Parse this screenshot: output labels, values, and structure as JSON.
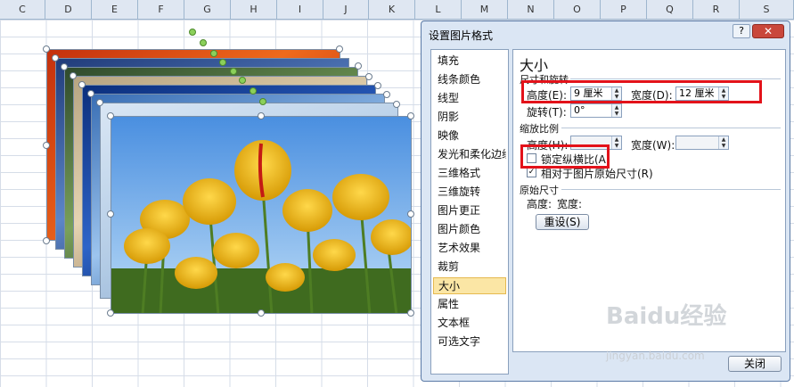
{
  "spreadsheet": {
    "columns": [
      "C",
      "D",
      "E",
      "F",
      "G",
      "H",
      "I",
      "J",
      "K",
      "L",
      "M",
      "N",
      "O",
      "P",
      "Q",
      "R",
      "S"
    ]
  },
  "dialog": {
    "title": "设置图片格式",
    "help_label": "?",
    "close_label": "✕",
    "nav_items": [
      "填充",
      "线条颜色",
      "线型",
      "阴影",
      "映像",
      "发光和柔化边缘",
      "三维格式",
      "三维旋转",
      "图片更正",
      "图片颜色",
      "艺术效果",
      "裁剪",
      "大小",
      "属性",
      "文本框",
      "可选文字"
    ],
    "selected_nav": "大小",
    "pane": {
      "heading": "大小",
      "section_size": "尺寸和旋转",
      "height_label": "高度(E):",
      "height_value": "9 厘米",
      "width_label": "宽度(D):",
      "width_value": "12 厘米",
      "rotation_label": "旋转(T):",
      "rotation_value": "0°",
      "section_scale": "缩放比例",
      "scale_height_label": "高度(H):",
      "scale_height_value": "",
      "scale_width_label": "宽度(W):",
      "scale_width_value": "",
      "lock_aspect_label": "锁定纵横比(A)",
      "relative_label": "相对于图片原始尺寸(R)",
      "section_original": "原始尺寸",
      "original_height_label": "高度:",
      "original_width_label": "宽度:",
      "reset_label": "重设(S)"
    },
    "footer_close_label": "关闭"
  },
  "watermark": {
    "logo_text": "Baidu经验",
    "url_text": "jingyan.baidu.com"
  },
  "colors": {
    "highlight_box": "#e3121a",
    "tulip_yellow": "#f3c20e",
    "sky_blue": "#6aa9e6"
  }
}
